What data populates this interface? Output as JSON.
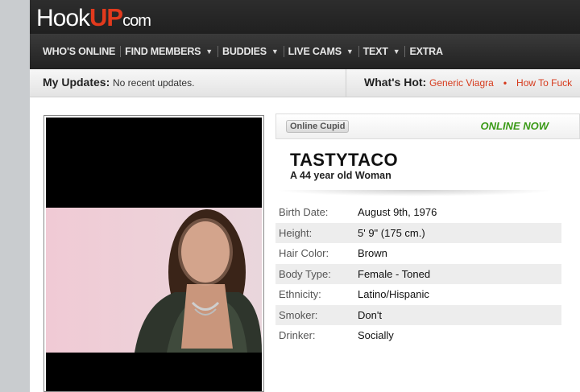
{
  "logo": {
    "part1": "Hook",
    "part2": "UP",
    "part3": "com"
  },
  "nav": [
    {
      "label": "WHO'S ONLINE",
      "caret": false
    },
    {
      "label": "FIND MEMBERS",
      "caret": true
    },
    {
      "label": "BUDDIES",
      "caret": true
    },
    {
      "label": "LIVE CAMS",
      "caret": true
    },
    {
      "label": "TEXT",
      "caret": true
    },
    {
      "label": "EXTRA",
      "caret": false
    }
  ],
  "updates": {
    "label": "My Updates:",
    "value": "No recent updates.",
    "hot_label": "What's Hot:",
    "hot_links": [
      "Generic Viagra",
      "How To Fuck"
    ]
  },
  "profile": {
    "cupid_badge": "Online Cupid",
    "status": "ONLINE NOW",
    "username": "TASTYTACO",
    "subtitle": "A 44 year old Woman",
    "details": [
      {
        "label": "Birth Date:",
        "value": "August 9th, 1976"
      },
      {
        "label": "Height:",
        "value": "5' 9\" (175 cm.)"
      },
      {
        "label": "Hair Color:",
        "value": "Brown"
      },
      {
        "label": "Body Type:",
        "value": "Female - Toned"
      },
      {
        "label": "Ethnicity:",
        "value": "Latino/Hispanic"
      },
      {
        "label": "Smoker:",
        "value": "Don't"
      },
      {
        "label": "Drinker:",
        "value": "Socially"
      }
    ]
  },
  "colors": {
    "accent": "#e23a1d",
    "online": "#3a9a16",
    "hot_link": "#d63a1c"
  }
}
